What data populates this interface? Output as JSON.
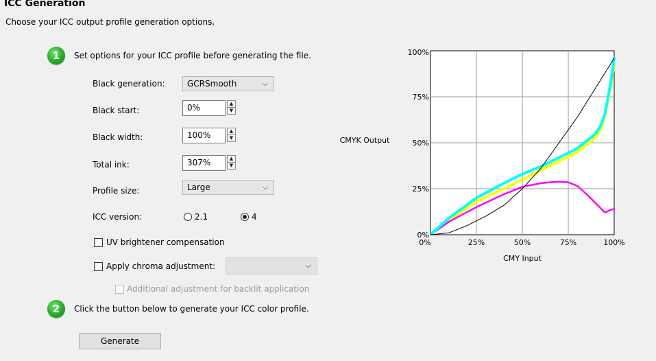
{
  "header": {
    "title": "ICC Generation",
    "subtitle": "Choose your ICC output profile generation options."
  },
  "step1": {
    "number": "1",
    "text": "Set options for your ICC profile before generating the file."
  },
  "options": {
    "black_generation": {
      "label": "Black generation:",
      "value": "GCRSmooth"
    },
    "black_start": {
      "label": "Black start:",
      "value": "0%"
    },
    "black_width": {
      "label": "Black width:",
      "value": "100%"
    },
    "total_ink": {
      "label": "Total ink:",
      "value": "307%"
    },
    "profile_size": {
      "label": "Profile size:",
      "value": "Large"
    },
    "icc_version": {
      "label": "ICC version:",
      "option1": "2.1",
      "option2": "4",
      "selected": "4"
    },
    "uv_brightener": {
      "label": "UV brightener compensation",
      "checked": false
    },
    "chroma_adjust": {
      "label": "Apply chroma adjustment:",
      "checked": false,
      "value": ""
    },
    "backlit": {
      "label": "Additional adjustment for backlit application",
      "checked": false,
      "enabled": false
    }
  },
  "step2": {
    "number": "2",
    "text": "Click the button below to generate your ICC color profile."
  },
  "generate_button": {
    "label": "Generate"
  },
  "chart_data": {
    "type": "line",
    "xlabel": "CMY Input",
    "ylabel": "CMYK Output",
    "x_ticks": [
      "0%",
      "25%",
      "50%",
      "75%",
      "100%"
    ],
    "y_ticks": [
      "0%",
      "25%",
      "50%",
      "75%",
      "100%"
    ],
    "xlim": [
      0,
      100
    ],
    "ylim": [
      0,
      100
    ],
    "grid": true,
    "series": [
      {
        "color": "#ffff00",
        "width": 4,
        "x": [
          0,
          10,
          25,
          40,
          50,
          60,
          70,
          80,
          90,
          93,
          95,
          98,
          100
        ],
        "y": [
          0,
          8,
          18,
          25,
          30,
          35,
          40,
          45,
          53,
          58,
          65,
          80,
          93
        ]
      },
      {
        "color": "#ff00ff",
        "width": 2.5,
        "x": [
          0,
          10,
          25,
          40,
          50,
          60,
          65,
          70,
          75,
          80,
          85,
          90,
          95,
          98,
          100
        ],
        "y": [
          0,
          7,
          15,
          22,
          26,
          28,
          28.5,
          28.8,
          28.5,
          26.5,
          22,
          17,
          12,
          13.5,
          14
        ]
      },
      {
        "color": "#00ffff",
        "width": 4,
        "x": [
          0,
          10,
          25,
          40,
          50,
          60,
          70,
          80,
          90,
          93,
          95,
          98,
          100
        ],
        "y": [
          0,
          9,
          20,
          28,
          33,
          37,
          42,
          47,
          55,
          60,
          66,
          82,
          96
        ]
      },
      {
        "color": "#000000",
        "width": 1,
        "x": [
          0,
          10,
          20,
          30,
          40,
          50,
          60,
          70,
          80,
          90,
          100
        ],
        "y": [
          0,
          1,
          5,
          10,
          16,
          25,
          36,
          50,
          64,
          80,
          96
        ]
      }
    ]
  }
}
